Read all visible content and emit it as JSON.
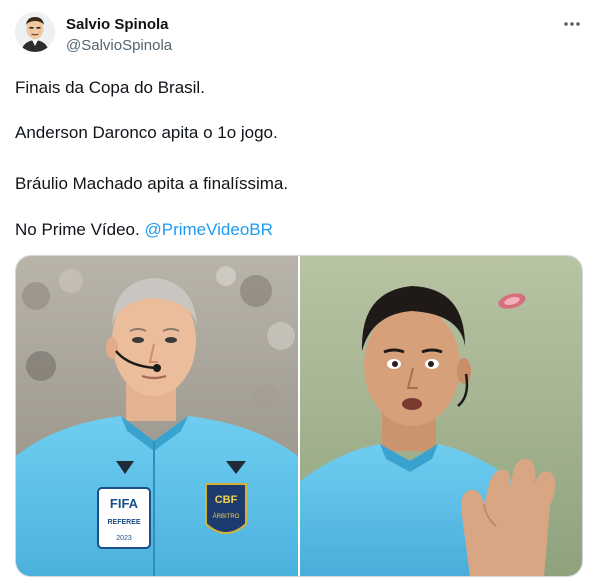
{
  "author": {
    "name": "Salvio Spinola",
    "handle": "@SalvioSpinola",
    "avatar_icon": "cartoon-portrait-avatar"
  },
  "menu": {
    "icon": "more-horizontal-icon"
  },
  "tweet": {
    "line1": "Finais da Copa do Brasil.",
    "line2": "Anderson Daronco apita o 1o jogo.",
    "line3": "Bráulio Machado apita a finalíssima.",
    "line4_prefix": "No Prime Vídeo.",
    "mention": "@PrimeVideoBR"
  },
  "media": {
    "left_photo": {
      "badge_fifa": "FIFA",
      "badge_referee": "REFEREE",
      "badge_year": "2023",
      "badge_cbf": "CBF",
      "badge_arbitro": "ÁRBITRO"
    },
    "right_photo": {}
  },
  "colors": {
    "accent": "#1d9bf0",
    "text": "#0f1419",
    "secondary": "#536471",
    "jersey": "#5ec3ea"
  }
}
